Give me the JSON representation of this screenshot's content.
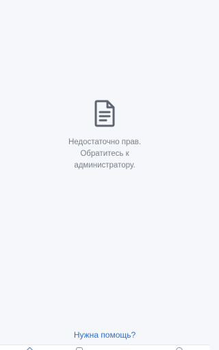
{
  "empty_state": {
    "icon": "document-icon",
    "message_lines": [
      "Недостаточно прав.",
      "Обратитесь к",
      "администратору."
    ]
  },
  "help_link": "Нужна помощь?",
  "colors": {
    "background": "#f5f7fb",
    "icon": "#5f6570",
    "message_text": "#7a8089",
    "link": "#2f6fd0"
  },
  "tabbar": {
    "icons": [
      "home-icon",
      "list-icon",
      "arrow-icon",
      "profile-icon"
    ],
    "active_index": 0
  }
}
